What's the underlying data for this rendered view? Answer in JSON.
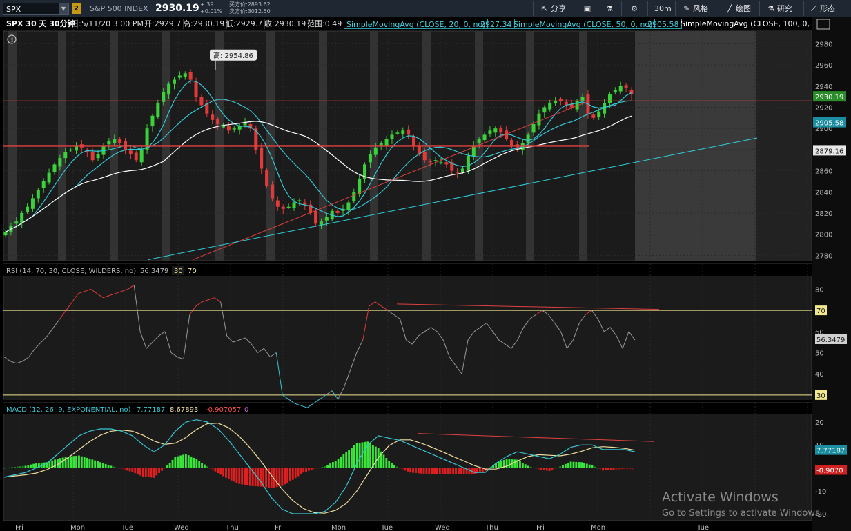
{
  "symbol": "SPX",
  "topbar": {
    "badge": "2",
    "index_name": "S&P 500 INDEX",
    "last_price": "2930.19",
    "change_abs": "+.39",
    "change_pct": "+0.01%",
    "bid": "买方价:2893.62",
    "ask": "卖方价:3012.50",
    "buttons": {
      "share": "分享",
      "timeframe": "30m",
      "style": "风格",
      "draw": "绘图",
      "study": "研究",
      "patterns": "形态"
    }
  },
  "infobar": {
    "title": "SPX 30 天 30分钟",
    "date": "日:5/11/20 3:00 PM",
    "open": "开:2929.7",
    "high": "高:2930.19",
    "low": "低:2929.7",
    "close": "收:2930.19",
    "range": "范围:0.49",
    "sma20_label": "SimpleMovingAvg (CLOSE, 20, 0, no)",
    "sma20_value": "2927.34",
    "sma50_label": "SimpleMovingAvg (CLOSE, 50, 0, no)",
    "sma50_value": "2905.58",
    "sma100_label": "SimpleMovingAvg (CLOSE, 100, 0, ..."
  },
  "price_panel": {
    "high_callout": "高: 2954.86",
    "y_ticks": [
      "2980",
      "2960",
      "2940",
      "2920",
      "2900",
      "2880",
      "2860",
      "2840",
      "2820",
      "2800",
      "2780"
    ],
    "last_badge": "2930.19",
    "sma50_badge": "2905.58",
    "sma100_badge": "2879.16"
  },
  "rsi_panel": {
    "label": "RSI (14, 70, 30, CLOSE, WILDERS, no)",
    "value": "56.3479",
    "ob": "30",
    "os": "70",
    "y_ticks": [
      "80",
      "70",
      "60",
      "50",
      "40",
      "30"
    ],
    "badge_70": "70",
    "badge_30": "30",
    "badge_value": "56.3479"
  },
  "macd_panel": {
    "label": "MACD (12, 26, 9, EXPONENTIAL, no)",
    "value": "7.77187",
    "avg": "8.67893",
    "diff": "-0.907057",
    "zero": "0",
    "y_ticks": [
      "20",
      "10",
      "-10",
      "-20"
    ],
    "badge_value": "7.77187",
    "badge_diff": "-0.9070"
  },
  "x_axis": [
    "Fri",
    "Mon",
    "Tue",
    "Wed",
    "Thu",
    "Fri",
    "Mon",
    "Tue",
    "Wed",
    "Thu",
    "Fri",
    "Mon",
    "Tue"
  ],
  "watermark": {
    "line1": "Activate Windows",
    "line2": "Go to Settings to activate Windows."
  },
  "colors": {
    "up": "#3ad13a",
    "down": "#e03a3a",
    "sma20": "#35c8d6",
    "sma50": "#35c8d6",
    "sma100": "#ffffff",
    "hline": "#e04040",
    "trend_cyan": "#2fd0dc",
    "rsi_ob_line": "#f0e68c",
    "macd_value": "#35c8d6",
    "macd_avg": "#f0e0a0",
    "macd_zero": "#d060d0"
  },
  "chart_data": {
    "type": "candlestick",
    "price_ohlc_approx": [
      2802,
      2808,
      2812,
      2820,
      2826,
      2834,
      2842,
      2850,
      2858,
      2866,
      2872,
      2878,
      2880,
      2884,
      2882,
      2878,
      2870,
      2876,
      2884,
      2888,
      2890,
      2886,
      2880,
      2876,
      2870,
      2880,
      2900,
      2912,
      2924,
      2934,
      2942,
      2946,
      2950,
      2952,
      2946,
      2930,
      2922,
      2914,
      2908,
      2904,
      2902,
      2898,
      2900,
      2902,
      2906,
      2900,
      2880,
      2862,
      2846,
      2834,
      2826,
      2824,
      2826,
      2830,
      2832,
      2828,
      2820,
      2810,
      2812,
      2816,
      2822,
      2820,
      2824,
      2830,
      2840,
      2852,
      2866,
      2876,
      2882,
      2886,
      2890,
      2894,
      2896,
      2898,
      2894,
      2884,
      2876,
      2870,
      2868,
      2870,
      2868,
      2866,
      2860,
      2858,
      2862,
      2874,
      2884,
      2890,
      2894,
      2898,
      2900,
      2896,
      2890,
      2884,
      2882,
      2886,
      2894,
      2904,
      2914,
      2920,
      2924,
      2926,
      2926,
      2922,
      2920,
      2926,
      2930,
      2914,
      2910,
      2916,
      2924,
      2932,
      2936,
      2940,
      2938,
      2932
    ],
    "rsi_approx": [
      48,
      46,
      45,
      46,
      48,
      52,
      55,
      58,
      62,
      66,
      70,
      74,
      78,
      79,
      80,
      78,
      76,
      77,
      78,
      79,
      80,
      82,
      60,
      52,
      55,
      58,
      60,
      50,
      48,
      47,
      68,
      72,
      74,
      75,
      76,
      74,
      58,
      55,
      56,
      57,
      54,
      50,
      52,
      48,
      50,
      30,
      28,
      26,
      25,
      24,
      26,
      28,
      30,
      32,
      28,
      34,
      42,
      50,
      56,
      72,
      74,
      72,
      70,
      68,
      66,
      56,
      54,
      58,
      60,
      62,
      60,
      56,
      48,
      44,
      40,
      56,
      60,
      62,
      64,
      60,
      56,
      54,
      52,
      56,
      62,
      66,
      68,
      70,
      68,
      64,
      60,
      52,
      56,
      64,
      68,
      70,
      66,
      60,
      62,
      58,
      52,
      60,
      56
    ],
    "macd_approx": [
      -4,
      -3,
      -2,
      0,
      2,
      6,
      10,
      14,
      16,
      17,
      17,
      16,
      14,
      10,
      7,
      10,
      16,
      20,
      21,
      20,
      17,
      12,
      6,
      0,
      -6,
      -13,
      -18,
      -20,
      -20,
      -20,
      -19,
      -15,
      -8,
      2,
      10,
      14,
      13,
      12,
      10,
      8,
      6,
      4,
      2,
      0,
      -2,
      -2,
      2,
      5,
      7,
      6,
      5,
      4,
      6,
      9,
      10,
      10,
      8,
      8,
      8,
      7
    ]
  }
}
